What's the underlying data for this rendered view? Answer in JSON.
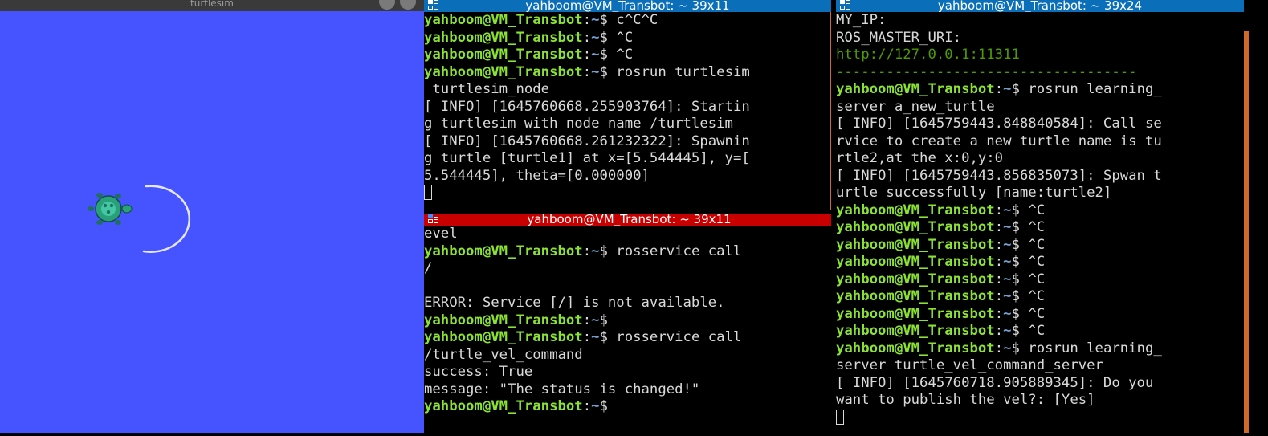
{
  "turtlesim": {
    "title": "turtlesim",
    "background_color": "#4554fe",
    "turtle_icon": "turtle-icon",
    "trail_color": "#ffffff"
  },
  "terminals": [
    {
      "title": "yahboom@VM_Transbot: ~ 39x11",
      "active": false,
      "lines": [
        {
          "prompt": true,
          "cmd": " c^C^C"
        },
        {
          "prompt": true,
          "cmd": " ^C"
        },
        {
          "prompt": true,
          "cmd": " ^C"
        },
        {
          "prompt": true,
          "cmd": " rosrun turtlesim"
        },
        {
          "text": " turtlesim_node"
        },
        {
          "text": "[ INFO] [1645760668.255903764]: Startin"
        },
        {
          "text": "g turtlesim with node name /turtlesim"
        },
        {
          "text": "[ INFO] [1645760668.261232322]: Spawnin"
        },
        {
          "text": "g turtle [turtle1] at x=[5.544445], y=["
        },
        {
          "text": "5.544445], theta=[0.000000]"
        },
        {
          "cursor": true
        }
      ]
    },
    {
      "title": "yahboom@VM_Transbot: ~ 39x11",
      "active": true,
      "lines": [
        {
          "text": "evel"
        },
        {
          "prompt": true,
          "cmd": " rosservice call"
        },
        {
          "text": "/"
        },
        {
          "text": ""
        },
        {
          "text": "ERROR: Service [/] is not available."
        },
        {
          "prompt": true,
          "cmd": ""
        },
        {
          "prompt": true,
          "cmd": " rosservice call"
        },
        {
          "text": "/turtle_vel_command"
        },
        {
          "text": "success: True"
        },
        {
          "text": "message: \"The status is changed!\""
        },
        {
          "prompt": true,
          "cmd": ""
        }
      ]
    },
    {
      "title": "yahboom@VM_Transbot: ~ 39x24",
      "active": false,
      "lines": [
        {
          "text": "MY_IP:"
        },
        {
          "text": "ROS_MASTER_URI:"
        },
        {
          "text": "http://127.0.0.1:11311",
          "green": true
        },
        {
          "text": "------------------------------------",
          "green": true
        },
        {
          "prompt": true,
          "cmd": " rosrun learning_"
        },
        {
          "text": "server a_new_turtle"
        },
        {
          "text": "[ INFO] [1645759443.848840584]: Call se"
        },
        {
          "text": "rvice to create a new turtle name is tu"
        },
        {
          "text": "rtle2,at the x:0,y:0"
        },
        {
          "text": "[ INFO] [1645759443.856835073]: Spwan t"
        },
        {
          "text": "urtle successfully [name:turtle2]"
        },
        {
          "prompt": true,
          "cmd": " ^C"
        },
        {
          "prompt": true,
          "cmd": " ^C"
        },
        {
          "prompt": true,
          "cmd": " ^C"
        },
        {
          "prompt": true,
          "cmd": " ^C"
        },
        {
          "prompt": true,
          "cmd": " ^C"
        },
        {
          "prompt": true,
          "cmd": " ^C"
        },
        {
          "prompt": true,
          "cmd": " ^C"
        },
        {
          "prompt": true,
          "cmd": " ^C"
        },
        {
          "prompt": true,
          "cmd": " rosrun learning_"
        },
        {
          "text": "server turtle_vel_command_server"
        },
        {
          "text": "[ INFO] [1645760718.905889345]: Do you"
        },
        {
          "text": "want to publish the vel?: [Yes]"
        },
        {
          "cursor": true
        }
      ]
    }
  ],
  "prompt": {
    "user": "yahboom@VM_Transbot",
    "sep": ":",
    "path": "~",
    "symbol": "$"
  },
  "colors": {
    "active_title": "#c90000",
    "inactive_title": "#0a6fb8",
    "prompt_user": "#8ae234",
    "prompt_path": "#729fcf",
    "scrollbar": "#d06a2a"
  }
}
